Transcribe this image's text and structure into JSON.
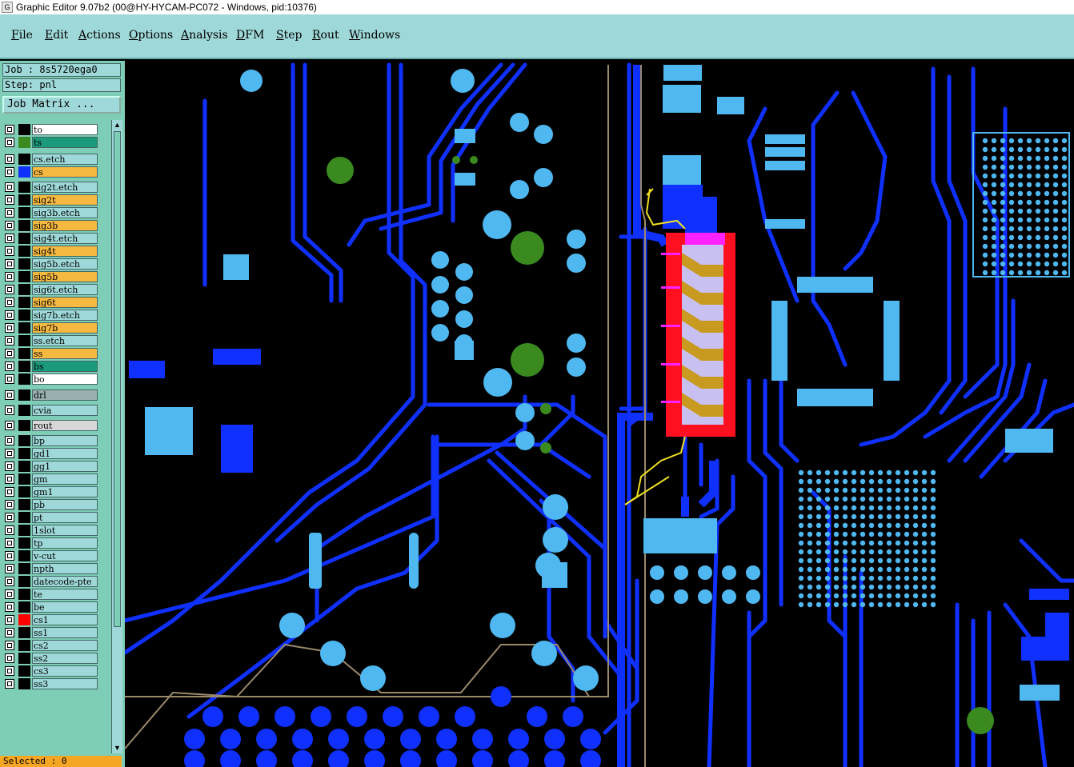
{
  "window": {
    "title": "Graphic Editor 9.07b2 (00@HY-HYCAM-PC072 - Windows, pid:10376)"
  },
  "menu": [
    "File",
    "Edit",
    "Actions",
    "Options",
    "Analysis",
    "DFM",
    "Step",
    "Rout",
    "Windows"
  ],
  "job": {
    "label": "Job : 8s5720ega0",
    "step": "Step: pnl",
    "matrix_button": "Job Matrix ..."
  },
  "layers": [
    {
      "name": "to",
      "color": "#000000",
      "bg": "#ffffff"
    },
    {
      "name": "ts",
      "color": "#3a8a20",
      "bg": "#1a9a7a"
    },
    {
      "name": "cs.etch",
      "color": "#000000",
      "bg": "#9fd8d8"
    },
    {
      "name": "cs",
      "color": "#1030ff",
      "bg": "#f5b841"
    },
    {
      "name": "sig2t.etch",
      "color": "#000000",
      "bg": "#9fd8d8"
    },
    {
      "name": "sig2t",
      "color": "#000000",
      "bg": "#f5b841"
    },
    {
      "name": "sig3b.etch",
      "color": "#000000",
      "bg": "#9fd8d8"
    },
    {
      "name": "sig3b",
      "color": "#000000",
      "bg": "#f5b841"
    },
    {
      "name": "sig4t.etch",
      "color": "#000000",
      "bg": "#9fd8d8"
    },
    {
      "name": "sig4t",
      "color": "#000000",
      "bg": "#f5b841"
    },
    {
      "name": "sig5b.etch",
      "color": "#000000",
      "bg": "#9fd8d8"
    },
    {
      "name": "sig5b",
      "color": "#000000",
      "bg": "#f5b841"
    },
    {
      "name": "sig6t.etch",
      "color": "#000000",
      "bg": "#9fd8d8"
    },
    {
      "name": "sig6t",
      "color": "#000000",
      "bg": "#f5b841"
    },
    {
      "name": "sig7b.etch",
      "color": "#000000",
      "bg": "#9fd8d8"
    },
    {
      "name": "sig7b",
      "color": "#000000",
      "bg": "#f5b841"
    },
    {
      "name": "ss.etch",
      "color": "#000000",
      "bg": "#9fd8d8"
    },
    {
      "name": "ss",
      "color": "#000000",
      "bg": "#f5b841"
    },
    {
      "name": "bs",
      "color": "#000000",
      "bg": "#1a9a7a"
    },
    {
      "name": "bo",
      "color": "#000000",
      "bg": "#ffffff"
    },
    {
      "name": "drl",
      "color": "#000000",
      "bg": "#9ab0b0"
    },
    {
      "name": "cvia",
      "color": "#000000",
      "bg": "#9fd8d8"
    },
    {
      "name": "rout",
      "color": "#000000",
      "bg": "#d8d8d8"
    },
    {
      "name": "bp",
      "color": "#000000",
      "bg": "#9fd8d8"
    },
    {
      "name": "gd1",
      "color": "#000000",
      "bg": "#9fd8d8"
    },
    {
      "name": "gg1",
      "color": "#000000",
      "bg": "#9fd8d8"
    },
    {
      "name": "gm",
      "color": "#000000",
      "bg": "#9fd8d8"
    },
    {
      "name": "gm1",
      "color": "#000000",
      "bg": "#9fd8d8"
    },
    {
      "name": "pb",
      "color": "#000000",
      "bg": "#9fd8d8"
    },
    {
      "name": "pt",
      "color": "#000000",
      "bg": "#9fd8d8"
    },
    {
      "name": "1slot",
      "color": "#000000",
      "bg": "#9fd8d8"
    },
    {
      "name": "tp",
      "color": "#000000",
      "bg": "#9fd8d8"
    },
    {
      "name": "v-cut",
      "color": "#000000",
      "bg": "#9fd8d8"
    },
    {
      "name": "npth",
      "color": "#000000",
      "bg": "#9fd8d8"
    },
    {
      "name": "datecode-pte",
      "color": "#000000",
      "bg": "#9fd8d8"
    },
    {
      "name": "te",
      "color": "#000000",
      "bg": "#9fd8d8"
    },
    {
      "name": "be",
      "color": "#000000",
      "bg": "#9fd8d8"
    },
    {
      "name": "cs1",
      "color": "#ff0000",
      "bg": "#9fd8d8"
    },
    {
      "name": "ss1",
      "color": "#000000",
      "bg": "#9fd8d8"
    },
    {
      "name": "cs2",
      "color": "#000000",
      "bg": "#9fd8d8"
    },
    {
      "name": "ss2",
      "color": "#000000",
      "bg": "#9fd8d8"
    },
    {
      "name": "cs3",
      "color": "#000000",
      "bg": "#9fd8d8"
    },
    {
      "name": "ss3",
      "color": "#000000",
      "bg": "#9fd8d8"
    }
  ],
  "status": {
    "selected": "Selected : 0"
  },
  "colors": {
    "trace": "#1030ff",
    "pad": "#4fb8f0",
    "highlight": "#ff1020",
    "menubar": "#9fd8d8"
  }
}
